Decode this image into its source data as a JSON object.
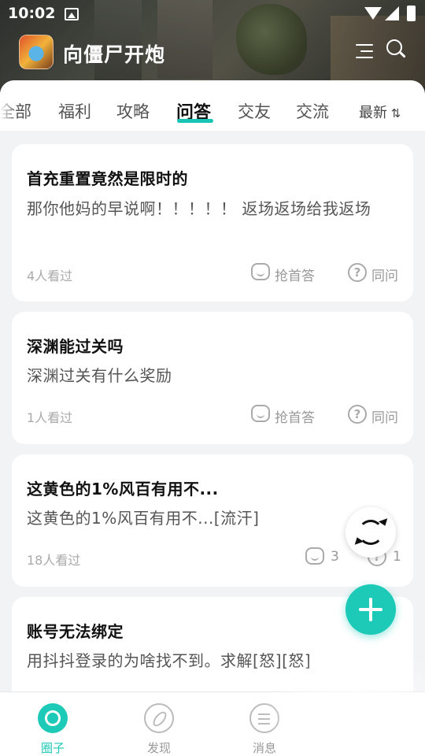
{
  "status_bar": {
    "time": "10:02"
  },
  "app_bar": {
    "title": "向僵尸开炮"
  },
  "tabs": [
    {
      "label": "全部",
      "active": false
    },
    {
      "label": "福利",
      "active": false
    },
    {
      "label": "攻略",
      "active": false
    },
    {
      "label": "问答",
      "active": true
    },
    {
      "label": "交友",
      "active": false
    },
    {
      "label": "交流",
      "active": false
    }
  ],
  "sort": {
    "label": "最新",
    "icon": "sort-arrows-icon"
  },
  "posts": [
    {
      "title": "首充重置竟然是限时的",
      "body": "那你他妈的早说啊！！！！！ 返场返场给我返场",
      "views": "4人看过",
      "answer_label": "抢首答",
      "ask_label": "同问"
    },
    {
      "title": "深渊能过关吗",
      "body": "深渊过关有什么奖励",
      "views": "1人看过",
      "answer_label": "抢首答",
      "ask_label": "同问"
    },
    {
      "title": "这黄色的1%风百有用不...",
      "body": "这黄色的1%风百有用不...[流汗]",
      "views": "18人看过",
      "answer_label": "3",
      "ask_label": "1"
    },
    {
      "title": "账号无法绑定",
      "body": "用抖抖登录的为啥找不到。求解[怒][怒]"
    }
  ],
  "bottom_nav": [
    {
      "label": "圈子",
      "icon": "circle-icon",
      "active": true
    },
    {
      "label": "发现",
      "icon": "compass-icon",
      "active": false
    },
    {
      "label": "消息",
      "icon": "message-icon",
      "active": false
    }
  ],
  "colors": {
    "accent": "#1dc9b7"
  }
}
